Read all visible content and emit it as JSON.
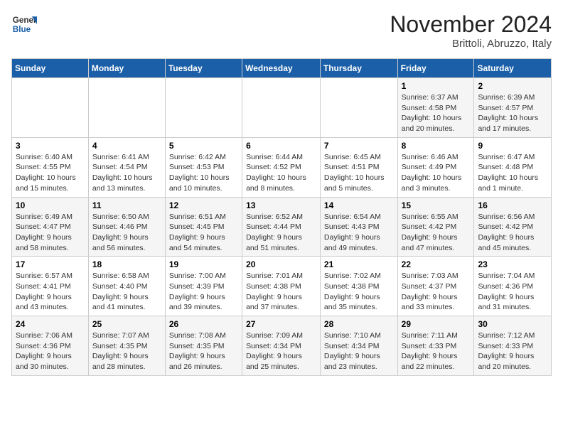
{
  "header": {
    "logo_general": "General",
    "logo_blue": "Blue",
    "month_title": "November 2024",
    "subtitle": "Brittoli, Abruzzo, Italy"
  },
  "days_of_week": [
    "Sunday",
    "Monday",
    "Tuesday",
    "Wednesday",
    "Thursday",
    "Friday",
    "Saturday"
  ],
  "weeks": [
    [
      {
        "day": "",
        "info": ""
      },
      {
        "day": "",
        "info": ""
      },
      {
        "day": "",
        "info": ""
      },
      {
        "day": "",
        "info": ""
      },
      {
        "day": "",
        "info": ""
      },
      {
        "day": "1",
        "info": "Sunrise: 6:37 AM\nSunset: 4:58 PM\nDaylight: 10 hours and 20 minutes."
      },
      {
        "day": "2",
        "info": "Sunrise: 6:39 AM\nSunset: 4:57 PM\nDaylight: 10 hours and 17 minutes."
      }
    ],
    [
      {
        "day": "3",
        "info": "Sunrise: 6:40 AM\nSunset: 4:55 PM\nDaylight: 10 hours and 15 minutes."
      },
      {
        "day": "4",
        "info": "Sunrise: 6:41 AM\nSunset: 4:54 PM\nDaylight: 10 hours and 13 minutes."
      },
      {
        "day": "5",
        "info": "Sunrise: 6:42 AM\nSunset: 4:53 PM\nDaylight: 10 hours and 10 minutes."
      },
      {
        "day": "6",
        "info": "Sunrise: 6:44 AM\nSunset: 4:52 PM\nDaylight: 10 hours and 8 minutes."
      },
      {
        "day": "7",
        "info": "Sunrise: 6:45 AM\nSunset: 4:51 PM\nDaylight: 10 hours and 5 minutes."
      },
      {
        "day": "8",
        "info": "Sunrise: 6:46 AM\nSunset: 4:49 PM\nDaylight: 10 hours and 3 minutes."
      },
      {
        "day": "9",
        "info": "Sunrise: 6:47 AM\nSunset: 4:48 PM\nDaylight: 10 hours and 1 minute."
      }
    ],
    [
      {
        "day": "10",
        "info": "Sunrise: 6:49 AM\nSunset: 4:47 PM\nDaylight: 9 hours and 58 minutes."
      },
      {
        "day": "11",
        "info": "Sunrise: 6:50 AM\nSunset: 4:46 PM\nDaylight: 9 hours and 56 minutes."
      },
      {
        "day": "12",
        "info": "Sunrise: 6:51 AM\nSunset: 4:45 PM\nDaylight: 9 hours and 54 minutes."
      },
      {
        "day": "13",
        "info": "Sunrise: 6:52 AM\nSunset: 4:44 PM\nDaylight: 9 hours and 51 minutes."
      },
      {
        "day": "14",
        "info": "Sunrise: 6:54 AM\nSunset: 4:43 PM\nDaylight: 9 hours and 49 minutes."
      },
      {
        "day": "15",
        "info": "Sunrise: 6:55 AM\nSunset: 4:42 PM\nDaylight: 9 hours and 47 minutes."
      },
      {
        "day": "16",
        "info": "Sunrise: 6:56 AM\nSunset: 4:42 PM\nDaylight: 9 hours and 45 minutes."
      }
    ],
    [
      {
        "day": "17",
        "info": "Sunrise: 6:57 AM\nSunset: 4:41 PM\nDaylight: 9 hours and 43 minutes."
      },
      {
        "day": "18",
        "info": "Sunrise: 6:58 AM\nSunset: 4:40 PM\nDaylight: 9 hours and 41 minutes."
      },
      {
        "day": "19",
        "info": "Sunrise: 7:00 AM\nSunset: 4:39 PM\nDaylight: 9 hours and 39 minutes."
      },
      {
        "day": "20",
        "info": "Sunrise: 7:01 AM\nSunset: 4:38 PM\nDaylight: 9 hours and 37 minutes."
      },
      {
        "day": "21",
        "info": "Sunrise: 7:02 AM\nSunset: 4:38 PM\nDaylight: 9 hours and 35 minutes."
      },
      {
        "day": "22",
        "info": "Sunrise: 7:03 AM\nSunset: 4:37 PM\nDaylight: 9 hours and 33 minutes."
      },
      {
        "day": "23",
        "info": "Sunrise: 7:04 AM\nSunset: 4:36 PM\nDaylight: 9 hours and 31 minutes."
      }
    ],
    [
      {
        "day": "24",
        "info": "Sunrise: 7:06 AM\nSunset: 4:36 PM\nDaylight: 9 hours and 30 minutes."
      },
      {
        "day": "25",
        "info": "Sunrise: 7:07 AM\nSunset: 4:35 PM\nDaylight: 9 hours and 28 minutes."
      },
      {
        "day": "26",
        "info": "Sunrise: 7:08 AM\nSunset: 4:35 PM\nDaylight: 9 hours and 26 minutes."
      },
      {
        "day": "27",
        "info": "Sunrise: 7:09 AM\nSunset: 4:34 PM\nDaylight: 9 hours and 25 minutes."
      },
      {
        "day": "28",
        "info": "Sunrise: 7:10 AM\nSunset: 4:34 PM\nDaylight: 9 hours and 23 minutes."
      },
      {
        "day": "29",
        "info": "Sunrise: 7:11 AM\nSunset: 4:33 PM\nDaylight: 9 hours and 22 minutes."
      },
      {
        "day": "30",
        "info": "Sunrise: 7:12 AM\nSunset: 4:33 PM\nDaylight: 9 hours and 20 minutes."
      }
    ]
  ]
}
